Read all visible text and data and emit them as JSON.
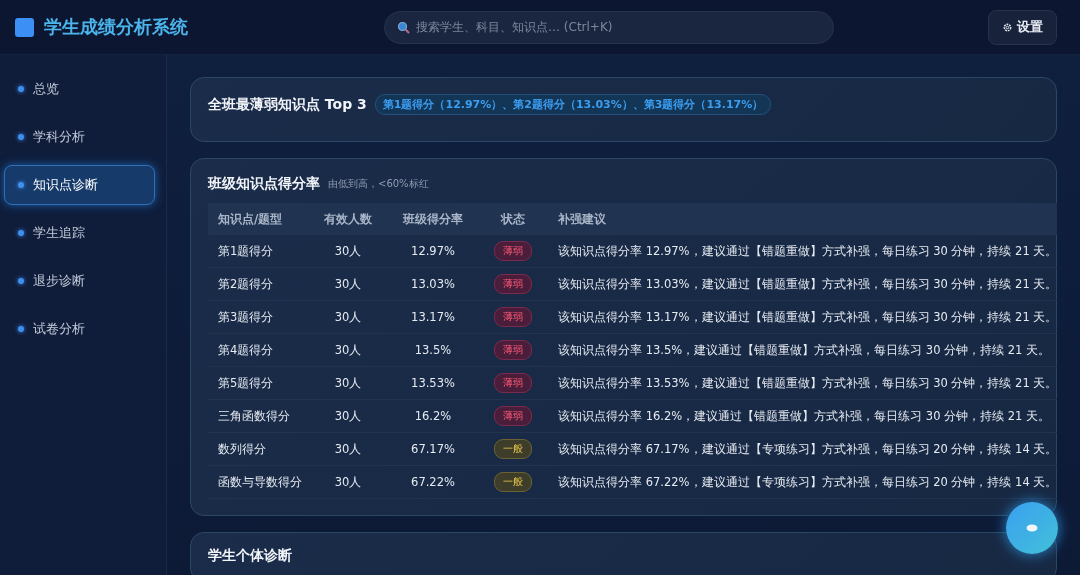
{
  "header": {
    "title": "学生成绩分析系统",
    "search": {
      "placeholder": "搜索学生、科目、知识点… (Ctrl+K)"
    },
    "settings_button": "设置"
  },
  "sidebar": {
    "items": [
      {
        "label": "总览",
        "selected": false
      },
      {
        "label": "学科分析",
        "selected": false
      },
      {
        "label": "知识点诊断",
        "selected": true
      },
      {
        "label": "学生追踪",
        "selected": false
      },
      {
        "label": "退步诊断",
        "selected": false
      },
      {
        "label": "试卷分析",
        "selected": false
      }
    ]
  },
  "top3": {
    "title": "全班最薄弱知识点 Top 3",
    "badge": "第1题得分（12.97%）、第2题得分（13.03%）、第3题得分（13.17%）"
  },
  "table_card": {
    "title": "班级知识点得分率",
    "subtitle": "由低到高，<60%标红",
    "columns": [
      "知识点/题型",
      "有效人数",
      "班级得分率",
      "状态",
      "补强建议"
    ],
    "rows": [
      {
        "name": "第1题得分",
        "count": "30人",
        "rate": "12.97%",
        "status": "薄弱",
        "kind": "weak",
        "advice": "该知识点得分率 12.97%，建议通过【错题重做】方式补强，每日练习 30 分钟，持续 21 天。"
      },
      {
        "name": "第2题得分",
        "count": "30人",
        "rate": "13.03%",
        "status": "薄弱",
        "kind": "weak",
        "advice": "该知识点得分率 13.03%，建议通过【错题重做】方式补强，每日练习 30 分钟，持续 21 天。"
      },
      {
        "name": "第3题得分",
        "count": "30人",
        "rate": "13.17%",
        "status": "薄弱",
        "kind": "weak",
        "advice": "该知识点得分率 13.17%，建议通过【错题重做】方式补强，每日练习 30 分钟，持续 21 天。"
      },
      {
        "name": "第4题得分",
        "count": "30人",
        "rate": "13.5%",
        "status": "薄弱",
        "kind": "weak",
        "advice": "该知识点得分率 13.5%，建议通过【错题重做】方式补强，每日练习 30 分钟，持续 21 天。"
      },
      {
        "name": "第5题得分",
        "count": "30人",
        "rate": "13.53%",
        "status": "薄弱",
        "kind": "weak",
        "advice": "该知识点得分率 13.53%，建议通过【错题重做】方式补强，每日练习 30 分钟，持续 21 天。"
      },
      {
        "name": "三角函数得分",
        "count": "30人",
        "rate": "16.2%",
        "status": "薄弱",
        "kind": "weak",
        "advice": "该知识点得分率 16.2%，建议通过【错题重做】方式补强，每日练习 30 分钟，持续 21 天。"
      },
      {
        "name": "数列得分",
        "count": "30人",
        "rate": "67.17%",
        "status": "一般",
        "kind": "normal",
        "advice": "该知识点得分率 67.17%，建议通过【专项练习】方式补强，每日练习 20 分钟，持续 14 天。"
      },
      {
        "name": "函数与导数得分",
        "count": "30人",
        "rate": "67.22%",
        "status": "一般",
        "kind": "normal",
        "advice": "该知识点得分率 67.22%，建议通过【专项练习】方式补强，每日练习 20 分钟，持续 14 天。"
      }
    ]
  },
  "student_card": {
    "title": "学生个体诊断"
  }
}
